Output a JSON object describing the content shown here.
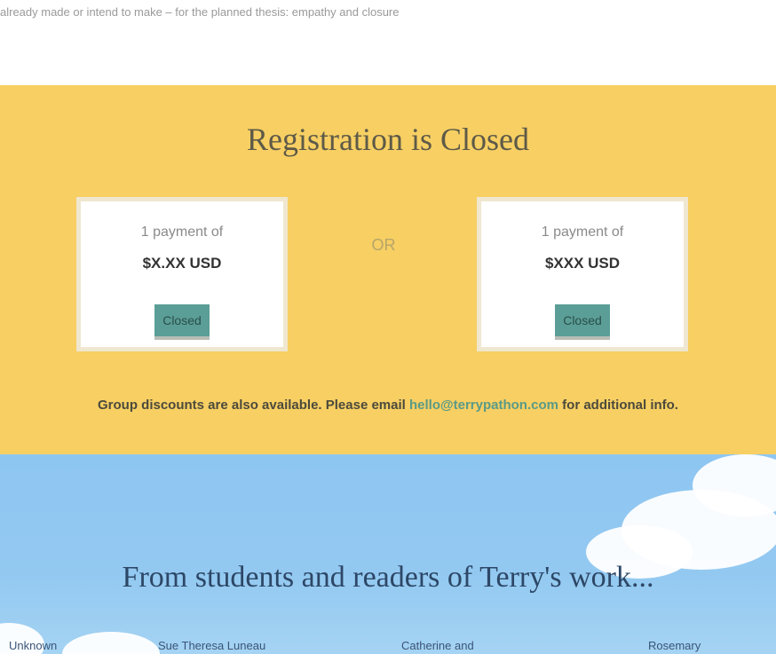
{
  "top_text": "already made or intend to make – for the planned thesis: empathy and closure",
  "registration": {
    "title": "Registration is Closed",
    "or_label": "OR",
    "cards": [
      {
        "label": "1 payment of",
        "price": "$X.XX USD",
        "button": "Closed"
      },
      {
        "label": "1 payment of",
        "price": "$XXX USD",
        "button": "Closed"
      }
    ],
    "group_text_before": "Group discounts are also available. Please email",
    "group_email": "hello@terrypathon.com",
    "group_text_after": "for additional info."
  },
  "testimonials": {
    "title": "From students and readers of Terry's work...",
    "names": [
      "Unknown",
      "Sue Theresa Luneau",
      "Catherine and",
      "Rosemary"
    ]
  },
  "colors": {
    "registration_bg": "#f7cf63",
    "button_bg": "#5b9e97",
    "sky": "#8ec6f2"
  }
}
